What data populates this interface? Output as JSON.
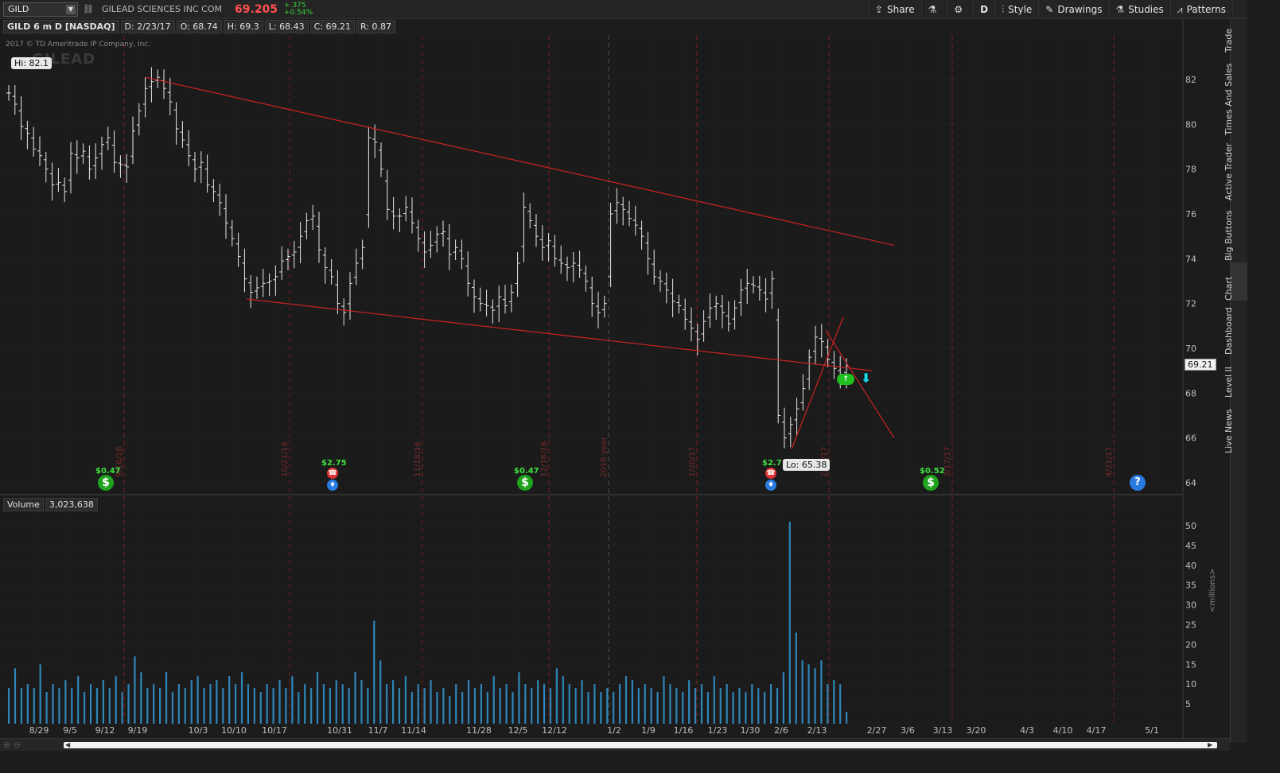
{
  "toolbar": {
    "symbol": "GILD",
    "company": "GILEAD SCIENCES INC COM",
    "last": "69.205",
    "change_abs": "+.375",
    "change_pct": "+0.54%",
    "buttons": {
      "share": "Share",
      "aggregation": "D",
      "style": "Style",
      "drawings": "Drawings",
      "studies": "Studies",
      "patterns": "Patterns"
    }
  },
  "infobar": {
    "title": "GILD 6 m D [NASDAQ]",
    "date": "D: 2/23/17",
    "open": "O: 68.74",
    "high": "H: 69.3",
    "low": "L: 68.43",
    "close": "C: 69.21",
    "range": "R: 0.87"
  },
  "copyright": "2017 © TD Ameritrade IP Company, Inc.",
  "watermark": "GILEAD",
  "hi_label": "Hi: 82.1",
  "lo_label": "Lo: 65.38",
  "price_tag": "69.21",
  "volume_panel": {
    "label": "Volume",
    "value": "3,023,638",
    "unit": "<millions>"
  },
  "dividends": [
    {
      "label": "$0.47"
    },
    {
      "label": "$2.75"
    },
    {
      "label": "$0.47"
    },
    {
      "label": "$2.7"
    },
    {
      "label": "$0.52"
    }
  ],
  "vertical_markers": [
    "9/16/16",
    "10/21/16",
    "11/18/16",
    "12/16/16",
    "2016 year",
    "1/20/17",
    "2/17/17",
    "3/17/17",
    "4/21/17"
  ],
  "sidebar": [
    "Trade",
    "Times And Sales",
    "Active Trader",
    "Big Buttons",
    "Chart",
    "Dashboard",
    "Level II",
    "Live News"
  ],
  "chart_data": {
    "type": "ohlc",
    "symbol": "GILD",
    "price_axis": {
      "ticks": [
        64,
        66,
        68,
        70,
        72,
        74,
        76,
        78,
        80,
        82
      ],
      "min": 63.5,
      "max": 83.5
    },
    "volume_axis": {
      "ticks": [
        5,
        10,
        15,
        20,
        25,
        30,
        35,
        40,
        45,
        50
      ],
      "unit": "millions"
    },
    "date_labels": [
      "8/29",
      "9/5",
      "9/12",
      "9/19",
      "10/3",
      "10/10",
      "10/17",
      "10/31",
      "11/7",
      "11/14",
      "11/28",
      "12/5",
      "12/12",
      "1/2",
      "1/9",
      "1/16",
      "1/23",
      "1/30",
      "2/6",
      "2/13",
      "2/27",
      "3/6",
      "3/13",
      "3/20",
      "4/3",
      "4/10",
      "4/17",
      "5/1"
    ],
    "closes": [
      81.4,
      80.9,
      79.9,
      79.6,
      78.9,
      78.6,
      78.0,
      77.3,
      77.4,
      77.0,
      78.7,
      78.5,
      78.8,
      78.0,
      78.5,
      79.1,
      79.4,
      78.3,
      78.2,
      78.1,
      79.7,
      80.6,
      81.6,
      81.9,
      82.1,
      81.6,
      81.0,
      79.8,
      79.3,
      78.6,
      78.0,
      78.3,
      77.3,
      77.0,
      76.5,
      75.6,
      74.9,
      74.1,
      73.1,
      72.5,
      72.7,
      72.9,
      73.0,
      73.2,
      73.9,
      74.1,
      74.3,
      75.0,
      75.7,
      75.9,
      74.4,
      73.6,
      73.2,
      72.0,
      71.6,
      72.9,
      73.8,
      74.5,
      79.4,
      79.2,
      78.0,
      76.2,
      75.9,
      75.9,
      76.3,
      75.6,
      74.9,
      74.3,
      74.6,
      75.1,
      75.2,
      74.2,
      74.5,
      74.0,
      72.9,
      72.3,
      72.0,
      71.9,
      71.7,
      72.3,
      71.9,
      72.5,
      73.8,
      76.3,
      75.7,
      75.0,
      74.5,
      74.8,
      74.0,
      73.8,
      73.6,
      73.8,
      73.5,
      73.0,
      72.0,
      71.6,
      72.0,
      76.0,
      76.5,
      76.2,
      75.8,
      75.5,
      75.0,
      74.0,
      73.2,
      73.0,
      72.6,
      72.1,
      71.9,
      71.3,
      70.9,
      70.4,
      71.2,
      71.8,
      72.0,
      71.6,
      71.1,
      71.8,
      72.6,
      72.9,
      72.8,
      72.6,
      72.2,
      73.1,
      67.0,
      66.0,
      66.6,
      67.3,
      68.2,
      69.6,
      70.5,
      70.3,
      69.5,
      69.1,
      68.8,
      69.21
    ],
    "volumes_millions": [
      9,
      14,
      9,
      10,
      9,
      15,
      8,
      10,
      9,
      11,
      9,
      12,
      8,
      10,
      9,
      11,
      9,
      12,
      8,
      10,
      17,
      13,
      9,
      10,
      9,
      13,
      8,
      10,
      9,
      11,
      12,
      9,
      10,
      11,
      9,
      12,
      10,
      13,
      10,
      9,
      8,
      10,
      9,
      11,
      9,
      12,
      8,
      10,
      9,
      13,
      10,
      9,
      11,
      10,
      9,
      13,
      11,
      9,
      26,
      16,
      10,
      11,
      9,
      12,
      8,
      10,
      9,
      11,
      8,
      9,
      7,
      10,
      8,
      11,
      9,
      10,
      8,
      12,
      9,
      10,
      8,
      13,
      10,
      9,
      11,
      10,
      9,
      14,
      12,
      10,
      9,
      11,
      8,
      10,
      8,
      9,
      8,
      10,
      12,
      11,
      9,
      10,
      9,
      8,
      12,
      10,
      9,
      8,
      11,
      9,
      10,
      8,
      12,
      9,
      10,
      8,
      9,
      8,
      10,
      9,
      8,
      10,
      9,
      13,
      51,
      23,
      16,
      15,
      14,
      16,
      10,
      11,
      10,
      3
    ],
    "trendlines": [
      {
        "from": [
          "9/19",
          82.1
        ],
        "to": [
          "3/1",
          74.6
        ],
        "color": "#cc2222"
      },
      {
        "from": [
          "10/11",
          72.2
        ],
        "to": [
          "2/23",
          69.0
        ],
        "color": "#cc2222"
      },
      {
        "from": [
          "2/6",
          65.5
        ],
        "to": [
          "2/16",
          71.4
        ],
        "color": "#cc2222"
      },
      {
        "from": [
          "2/14",
          70.8
        ],
        "to": [
          "3/1",
          66.0
        ],
        "color": "#cc2222"
      }
    ]
  }
}
